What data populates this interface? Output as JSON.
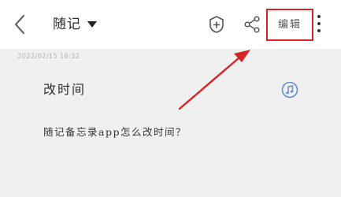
{
  "header": {
    "title": "随记",
    "edit_label": "编辑",
    "icons": {
      "back": "back-chevron-icon",
      "dropdown": "caret-down-icon",
      "tag": "tag-add-icon",
      "share": "share-icon",
      "more": "more-vertical-icon"
    }
  },
  "note": {
    "datetime": "2022/02/15 16:32",
    "title": "改时间",
    "body": "随记备忘录app怎么改时间？",
    "attachment_icon": "music-note-icon"
  },
  "annotation": {
    "highlight_color": "#d92424",
    "arrow_color": "#d92424"
  },
  "colors": {
    "header_bg": "#ffffff",
    "content_bg": "#f0f0f0",
    "accent_blue": "#5b8fd6"
  }
}
